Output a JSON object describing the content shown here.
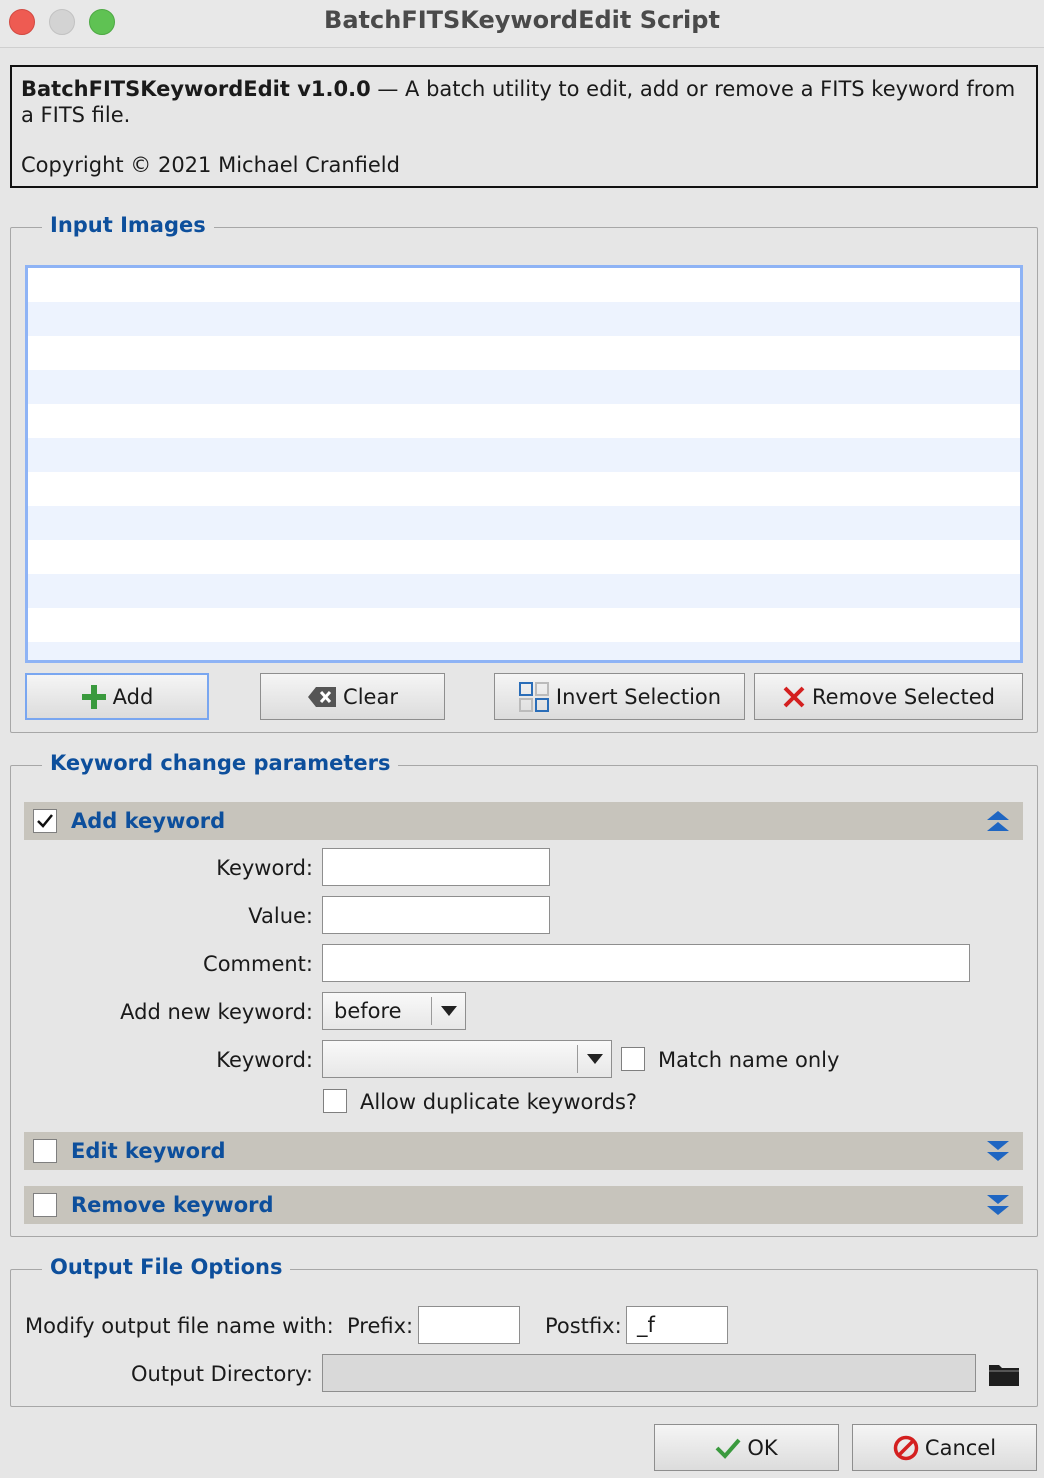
{
  "window": {
    "title": "BatchFITSKeywordEdit Script"
  },
  "info": {
    "name": "BatchFITSKeywordEdit v1.0.0",
    "description": " — A batch utility to edit, add or remove a FITS keyword from a FITS file.",
    "copyright": "Copyright © 2021 Michael Cranfield"
  },
  "input_images": {
    "title": "Input Images",
    "files": [],
    "buttons": {
      "add": "Add",
      "clear": "Clear",
      "invert": "Invert Selection",
      "remove": "Remove Selected"
    }
  },
  "keyword_params": {
    "title": "Keyword change parameters",
    "add_section": {
      "label": "Add keyword",
      "checked": true,
      "keyword_label": "Keyword:",
      "keyword_value": "",
      "value_label": "Value:",
      "value_value": "",
      "comment_label": "Comment:",
      "comment_value": "",
      "position_label": "Add new keyword:",
      "position_value": "before",
      "ref_keyword_label": "Keyword:",
      "ref_keyword_value": "",
      "match_name_label": "Match name only",
      "match_name_checked": false,
      "allow_dup_label": "Allow duplicate keywords?",
      "allow_dup_checked": false
    },
    "edit_section": {
      "label": "Edit keyword",
      "checked": false
    },
    "remove_section": {
      "label": "Remove keyword",
      "checked": false
    }
  },
  "output": {
    "title": "Output File Options",
    "modify_label": "Modify output file name with:",
    "prefix_label": "Prefix:",
    "prefix_value": "",
    "postfix_label": "Postfix:",
    "postfix_value": "_f",
    "dir_label": "Output Directory:",
    "dir_value": ""
  },
  "footer": {
    "ok": "OK",
    "cancel": "Cancel"
  },
  "colors": {
    "accent": "#0d4f9c",
    "section_bar": "#c7c4bc",
    "list_alt_row": "#edf3fe",
    "focus_border": "#8eb3f5"
  }
}
